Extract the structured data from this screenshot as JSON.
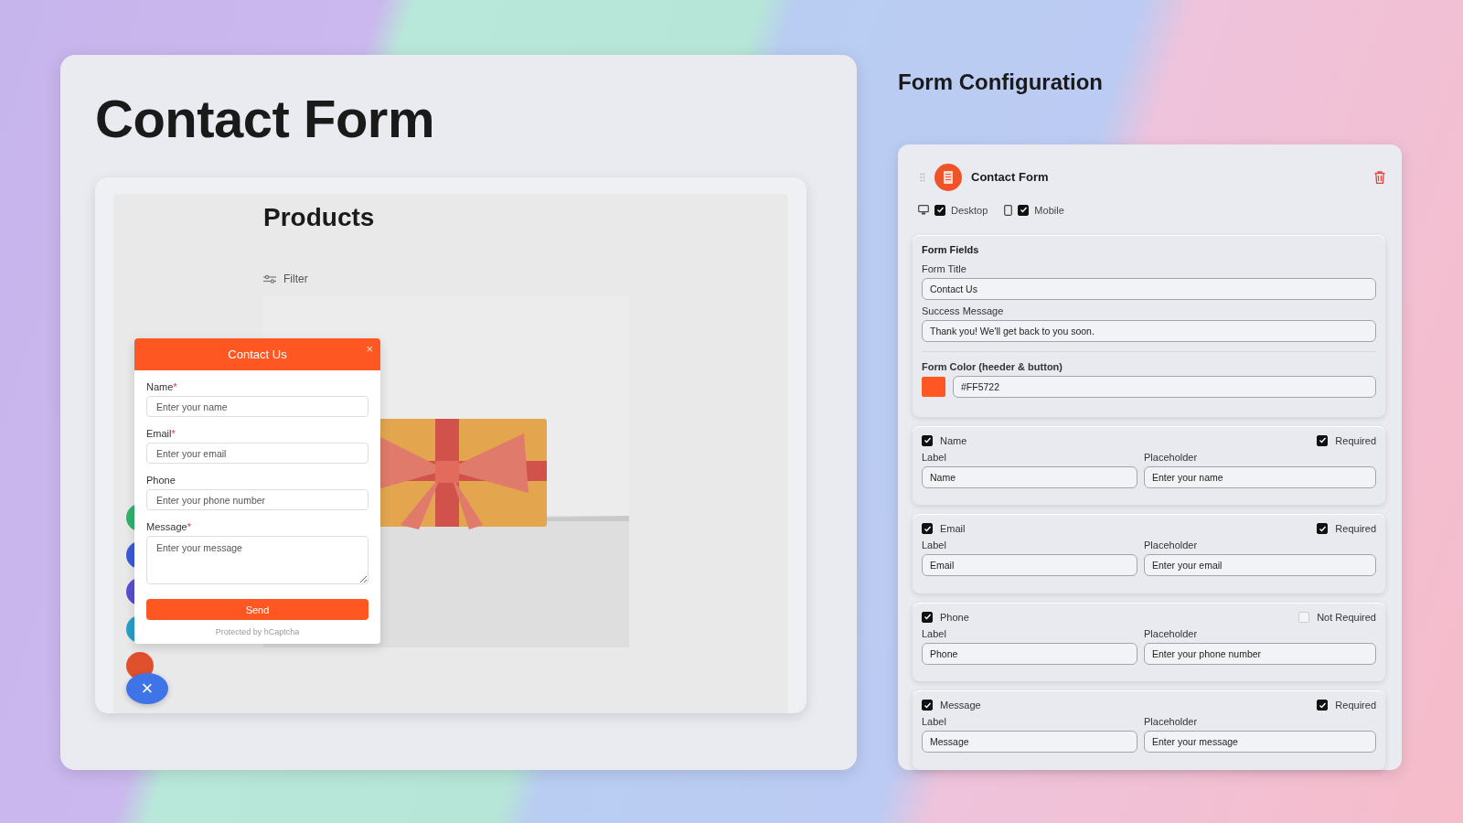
{
  "page_title": "Contact Form",
  "preview": {
    "heading": "Products",
    "filter": "Filter",
    "floating_buttons": [
      {
        "color": "#2fb36b"
      },
      {
        "color": "#3b5bd6"
      },
      {
        "color": "#5a4fcf"
      },
      {
        "color": "#2a9fc9"
      },
      {
        "color": "#e0502c"
      }
    ],
    "close_fab": "×",
    "popup": {
      "title": "Contact Us",
      "close": "×",
      "required_mark": "*",
      "fields": [
        {
          "kind": "input",
          "label": "Name",
          "required": true,
          "placeholder": "Enter your name"
        },
        {
          "kind": "input",
          "label": "Email",
          "required": true,
          "placeholder": "Enter your email"
        },
        {
          "kind": "input",
          "label": "Phone",
          "required": false,
          "placeholder": "Enter your phone number"
        },
        {
          "kind": "textarea",
          "label": "Message",
          "required": true,
          "placeholder": "Enter your message"
        }
      ],
      "submit": "Send",
      "footer": "Protected by hCaptcha"
    }
  },
  "config": {
    "title": "Form Configuration",
    "widget_name": "Contact Form",
    "devices": [
      {
        "kind": "desktop",
        "label": "Desktop",
        "checked": true
      },
      {
        "kind": "mobile",
        "label": "Mobile",
        "checked": true
      }
    ],
    "form_fields": {
      "heading": "Form Fields",
      "form_title": {
        "label": "Form Title",
        "value": "Contact Us"
      },
      "success_message": {
        "label": "Success Message",
        "value": "Thank you! We'll get back to you soon."
      },
      "form_color": {
        "label": "Form Color (heeder & button)",
        "value": "#FF5722"
      }
    },
    "fields": [
      {
        "name": "Name",
        "enabled": true,
        "required": true,
        "required_label": "Required",
        "label_input": {
          "caption": "Label",
          "value": "Name"
        },
        "placeholder_input": {
          "caption": "Placeholder",
          "value": "Enter your name"
        }
      },
      {
        "name": "Email",
        "enabled": true,
        "required": true,
        "required_label": "Required",
        "label_input": {
          "caption": "Label",
          "value": "Email"
        },
        "placeholder_input": {
          "caption": "Placeholder",
          "value": "Enter your email"
        }
      },
      {
        "name": "Phone",
        "enabled": true,
        "required": false,
        "required_label": "Not Required",
        "label_input": {
          "caption": "Label",
          "value": "Phone"
        },
        "placeholder_input": {
          "caption": "Placeholder",
          "value": "Enter your phone number"
        }
      },
      {
        "name": "Message",
        "enabled": true,
        "required": true,
        "required_label": "Required",
        "label_input": {
          "caption": "Label",
          "value": "Message"
        },
        "placeholder_input": {
          "caption": "Placeholder",
          "value": "Enter your message"
        }
      }
    ]
  }
}
